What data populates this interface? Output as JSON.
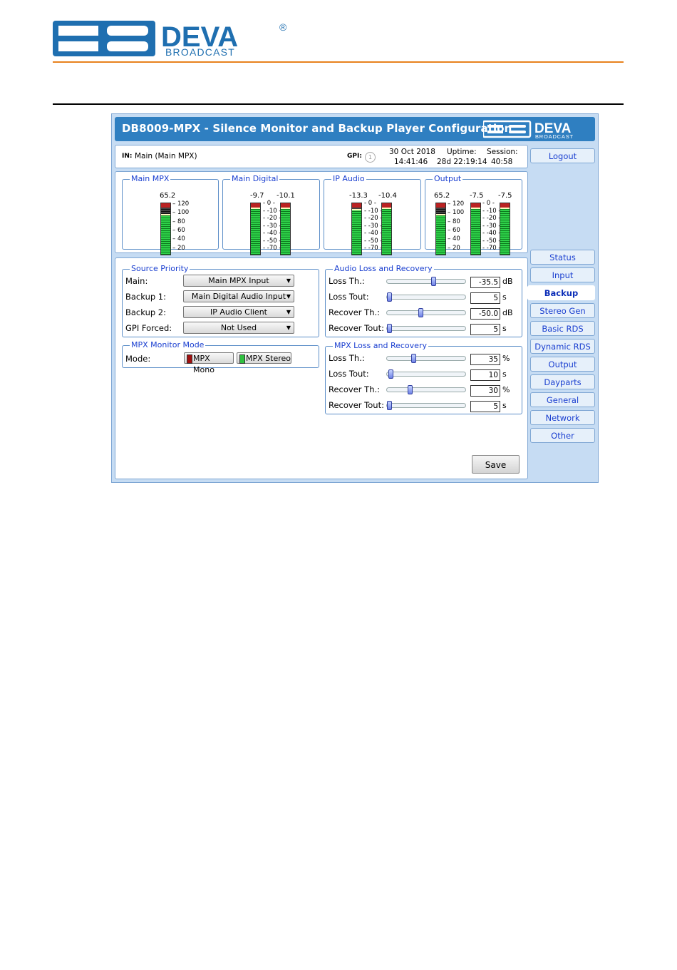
{
  "brand": {
    "logo_text": "DEVA",
    "logo_sub": "BROADCAST",
    "registered": "®"
  },
  "app": {
    "title": "DB8009-MPX - Silence Monitor and Backup Player Configuration",
    "title_logo_text": "DEVA",
    "title_logo_sub": "BROADCAST"
  },
  "info": {
    "in_label": "IN:",
    "in_value": "Main (Main MPX)",
    "gpi_label": "GPI:",
    "gpi_value": "1",
    "date": "30 Oct 2018",
    "time": "14:41:46",
    "uptime_label": "Uptime:",
    "uptime_value": "28d 22:19:14",
    "session_label": "Session:",
    "session_value": "40:58"
  },
  "meters": [
    {
      "title": "Main MPX",
      "values": [
        "65.2"
      ],
      "scale": [
        "120",
        "100",
        "80",
        "60",
        "40",
        "20"
      ],
      "levels": [
        0.78
      ],
      "type": "mpx"
    },
    {
      "title": "Main Digital",
      "values": [
        "-9.7",
        "-10.1"
      ],
      "scale": [
        "0",
        "-10",
        "-20",
        "-30",
        "-40",
        "-50",
        "-70"
      ],
      "levels": [
        0.92,
        0.92
      ],
      "type": "db"
    },
    {
      "title": "IP Audio",
      "values": [
        "-13.3",
        "-10.4"
      ],
      "scale": [
        "0",
        "-10",
        "-20",
        "-30",
        "-40",
        "-50",
        "-70"
      ],
      "levels": [
        0.88,
        0.92
      ],
      "type": "db"
    },
    {
      "title": "Output",
      "values": [
        "65.2",
        "-7.5",
        "-7.5"
      ],
      "scale_mpx": [
        "120",
        "100",
        "80",
        "60",
        "40",
        "20"
      ],
      "scale_db": [
        "0",
        "-10",
        "-20",
        "-30",
        "-40",
        "-50",
        "-70"
      ],
      "levels": [
        0.78,
        0.94,
        0.94
      ],
      "type": "out"
    }
  ],
  "source_priority": {
    "title": "Source Priority",
    "rows": [
      {
        "label": "Main:",
        "value": "Main MPX Input"
      },
      {
        "label": "Backup 1:",
        "value": "Main Digital Audio Input"
      },
      {
        "label": "Backup 2:",
        "value": "IP Audio Client"
      },
      {
        "label": "GPI Forced:",
        "value": "Not Used"
      }
    ]
  },
  "mpx_monitor": {
    "title": "MPX Monitor Mode",
    "label": "Mode:",
    "mono": "MPX Mono",
    "stereo": "MPX Stereo",
    "mono_color": "#a01010",
    "stereo_color": "#30c040"
  },
  "audio_loss": {
    "title": "Audio Loss and Recovery",
    "rows": [
      {
        "label": "Loss Th.:",
        "value": "-35.5",
        "unit": "dB",
        "pos": 0.6
      },
      {
        "label": "Loss Tout:",
        "value": "5",
        "unit": "s",
        "pos": 0.0
      },
      {
        "label": "Recover Th.:",
        "value": "-50.0",
        "unit": "dB",
        "pos": 0.43
      },
      {
        "label": "Recover Tout:",
        "value": "5",
        "unit": "s",
        "pos": 0.0
      }
    ]
  },
  "mpx_loss": {
    "title": "MPX Loss and Recovery",
    "rows": [
      {
        "label": "Loss Th.:",
        "value": "35",
        "unit": "%",
        "pos": 0.33
      },
      {
        "label": "Loss Tout:",
        "value": "10",
        "unit": "s",
        "pos": 0.02
      },
      {
        "label": "Recover Th.:",
        "value": "30",
        "unit": "%",
        "pos": 0.28
      },
      {
        "label": "Recover Tout:",
        "value": "5",
        "unit": "s",
        "pos": 0.0
      }
    ]
  },
  "save_label": "Save",
  "nav": {
    "logout": "Logout",
    "items": [
      "Status",
      "Input",
      "Backup",
      "Stereo Gen",
      "Basic RDS",
      "Dynamic RDS",
      "Output",
      "Dayparts",
      "General",
      "Network",
      "Other"
    ],
    "active": "Backup"
  },
  "colors": {
    "accent": "#2f7fc1",
    "frame": "#c6dcf3",
    "legend": "#1a3fd0",
    "orange": "#e8821e"
  }
}
